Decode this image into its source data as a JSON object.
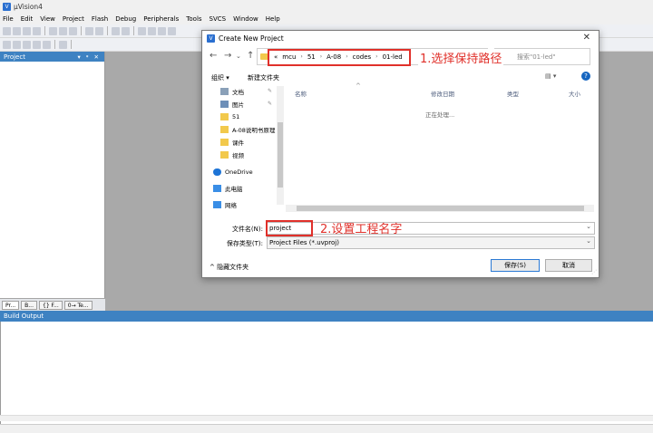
{
  "app": {
    "title": "µVision4",
    "icon_letter": "V"
  },
  "menu": [
    "File",
    "Edit",
    "View",
    "Project",
    "Flash",
    "Debug",
    "Peripherals",
    "Tools",
    "SVCS",
    "Window",
    "Help"
  ],
  "project_panel": {
    "title": "Project",
    "controls": "▾ ᵠ ✕",
    "tabs": [
      "Pr...",
      "B...",
      "{} F...",
      "0→ Te..."
    ]
  },
  "build_output": {
    "title": "Build Output"
  },
  "dialog": {
    "title": "Create New Project",
    "close": "✕",
    "breadcrumb": [
      "«",
      "mcu",
      "51",
      "A-08",
      "codes",
      "01-led"
    ],
    "search_placeholder": "搜索\"01-led\"",
    "organize": "组织 ▾",
    "new_folder": "新建文件夹",
    "view_icons": "▤ ▾",
    "help": "?",
    "nav_items": [
      {
        "label": "文档",
        "icon_color": "#8aa0b8"
      },
      {
        "label": "图片",
        "icon_color": "#6d8fb8"
      },
      {
        "label": "51",
        "icon_color": "#f2c94c"
      },
      {
        "label": "A-08说明书原理",
        "icon_color": "#f2c94c"
      },
      {
        "label": "课件",
        "icon_color": "#f2c94c"
      },
      {
        "label": "视频",
        "icon_color": "#f2c94c"
      },
      {
        "label": "OneDrive",
        "icon_color": "#1e74d6"
      },
      {
        "label": "此电脑",
        "icon_color": "#3a8ee6"
      },
      {
        "label": "网络",
        "icon_color": "#3a8ee6"
      }
    ],
    "columns": [
      "名称",
      "修改日期",
      "类型",
      "大小"
    ],
    "processing": "正在处理...",
    "filename_label": "文件名(N):",
    "filename_value": "project",
    "filetype_label": "保存类型(T):",
    "filetype_value": "Project Files (*.uvproj)",
    "hide_folders": "^  隐藏文件夹",
    "save_button": "保存(S)",
    "cancel_button": "取消"
  },
  "annotations": {
    "step1": "1.选择保持路径",
    "step2": "2.设置工程名字",
    "color": "#e0302a"
  }
}
